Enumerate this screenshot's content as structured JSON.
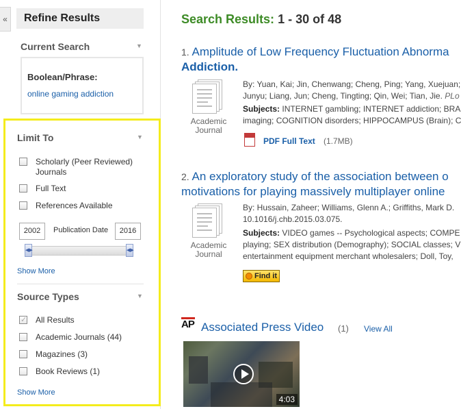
{
  "sidebar": {
    "collapse_glyph": "«",
    "refine_title": "Refine Results",
    "current_search": {
      "title": "Current Search",
      "bool_label": "Boolean/Phrase:",
      "bool_value": "online gaming addiction"
    },
    "limit_to": {
      "title": "Limit To",
      "options": [
        {
          "label": "Scholarly (Peer Reviewed) Journals",
          "checked": false
        },
        {
          "label": "Full Text",
          "checked": false
        },
        {
          "label": "References Available",
          "checked": false
        }
      ],
      "publication_date": {
        "label": "Publication Date",
        "from": "2002",
        "to": "2016"
      },
      "show_more": "Show More"
    },
    "source_types": {
      "title": "Source Types",
      "options": [
        {
          "label": "All Results",
          "checked": true
        },
        {
          "label": "Academic Journals (44)",
          "checked": false
        },
        {
          "label": "Magazines (3)",
          "checked": false
        },
        {
          "label": "Book Reviews (1)",
          "checked": false
        }
      ],
      "show_more": "Show More"
    },
    "highlight_color": "#f4ec1c"
  },
  "results": {
    "heading_label": "Search Results:",
    "heading_count": "1 - 30 of 48",
    "items": [
      {
        "num": "1.",
        "title_line1": "Amplitude of Low Frequency Fluctuation Abnorma",
        "title_line2": "Addiction.",
        "type": "Academic Journal",
        "authors_line1": "By: Yuan, Kai; Jin, Chenwang; Cheng, Ping; Yang, Xuejuan;",
        "authors_line2": "Junyu; Liang, Jun; Cheng, Tingting; Qin, Wei; Tian, Jie.",
        "journal_fragment": "PLo",
        "subjects_label": "Subjects:",
        "subjects_line1": "INTERNET gambling; INTERNET addiction; BRA",
        "subjects_line2": "imaging; COGNITION disorders; HIPPOCAMPUS (Brain); C",
        "pdf_label": "PDF Full Text",
        "pdf_size": "(1.7MB)"
      },
      {
        "num": "2.",
        "title_line1": "An exploratory study of the association between o",
        "title_line2": "motivations for playing massively multiplayer online",
        "type": "Academic Journal",
        "authors_line1": "By: Hussain, Zaheer; Williams, Glenn A.; Griffiths, Mark D.",
        "authors_line2": "10.1016/j.chb.2015.03.075.",
        "subjects_label": "Subjects:",
        "subjects_line1": "VIDEO games -- Psychological aspects; COMPE",
        "subjects_line2": "playing; SEX distribution (Demography); SOCIAL classes; V",
        "subjects_line3": "entertainment equipment merchant wholesalers; Doll, Toy,",
        "findit_label": "Find it"
      }
    ],
    "ap_video": {
      "logo": "AP",
      "title": "Associated Press Video",
      "count": "(1)",
      "view_all": "View All",
      "duration": "4:03"
    }
  }
}
